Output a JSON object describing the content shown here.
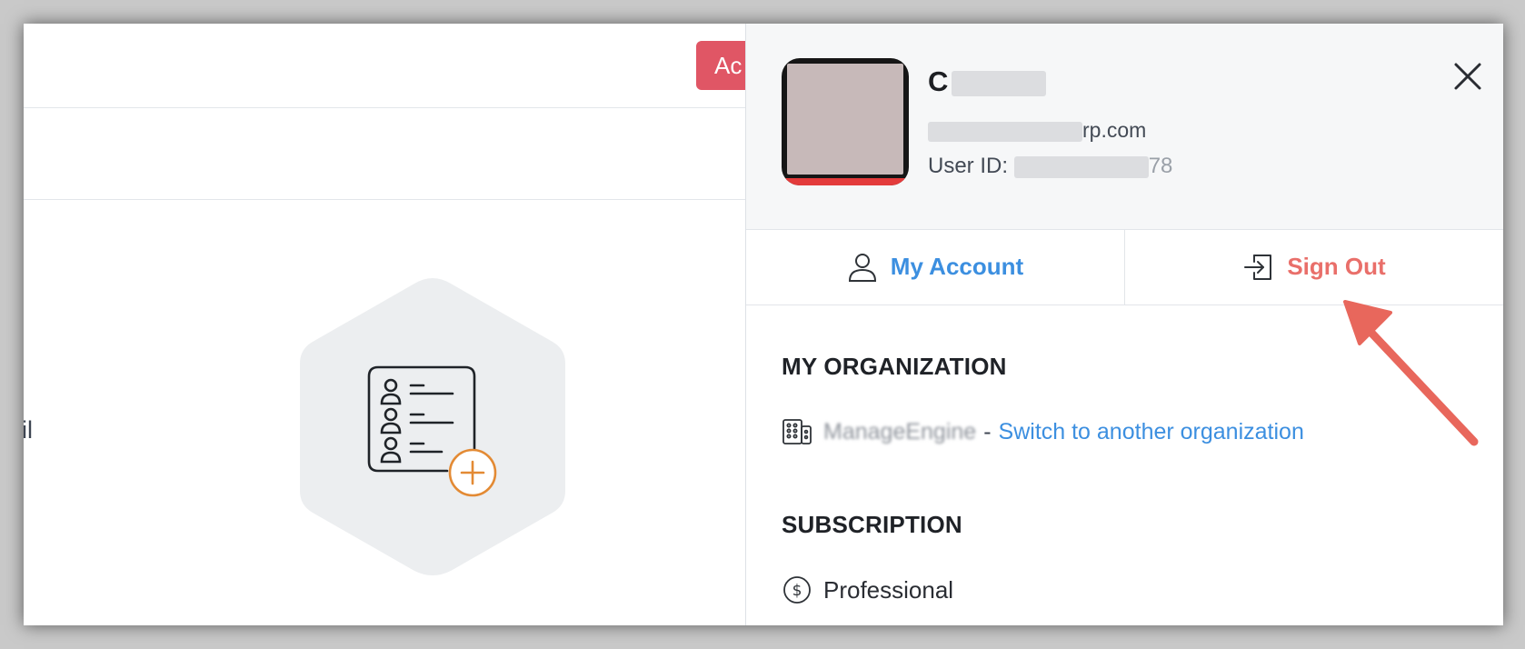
{
  "background_app": {
    "add_button_label": "Ac",
    "partial_text": "il"
  },
  "profile": {
    "name": "C",
    "email_suffix": "rp.com",
    "user_id_label": "User ID: ",
    "user_id_tail": "78"
  },
  "actions": {
    "my_account": "My Account",
    "sign_out": "Sign Out"
  },
  "organization": {
    "title": "MY ORGANIZATION",
    "org_name": "ManageEngine",
    "separator": "-",
    "switch_link": "Switch to another organization"
  },
  "subscription": {
    "title": "SUBSCRIPTION",
    "plan": "Professional"
  },
  "colors": {
    "accent_blue": "#3c8fe0",
    "sign_out_red": "#e96f6a",
    "add_button": "#e05665",
    "annotation_arrow": "#e8675c",
    "illustration_orange": "#e38a34"
  },
  "icons": {
    "close": "close-icon",
    "account": "user-icon",
    "sign_out": "sign-out-icon",
    "organization": "building-icon",
    "subscription": "dollar-icon",
    "illustration": "contact-list-add-icon"
  }
}
